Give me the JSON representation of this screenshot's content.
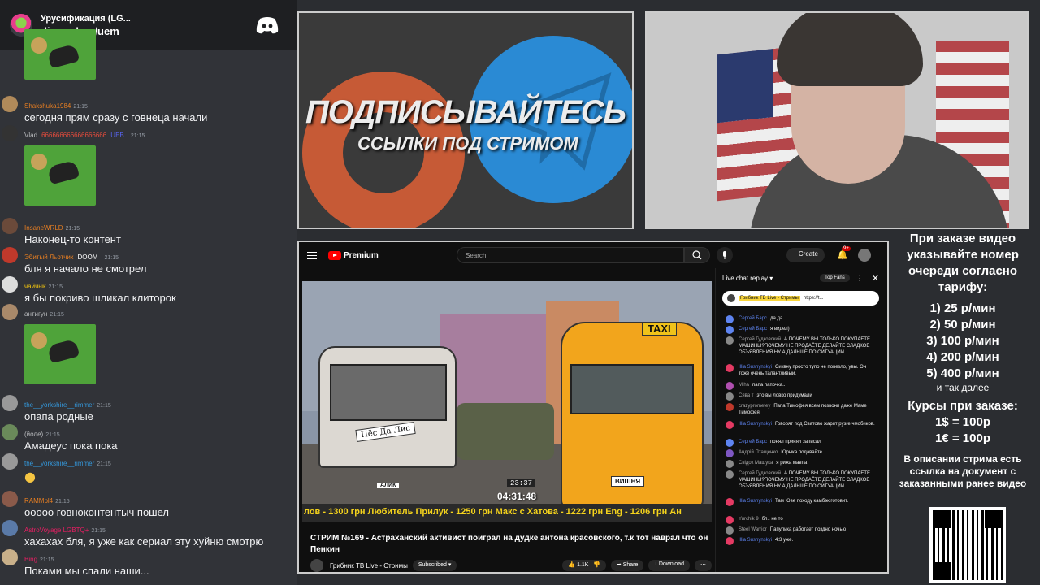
{
  "discord": {
    "server_name": "Урусификация (LG...",
    "server_link": "discord.gg/uem",
    "messages": [
      {
        "user": "Shakshuka1984",
        "time": "21:15",
        "text": "сегодня прям сразу с говнеца начали",
        "color": "#e67e22"
      },
      {
        "user": "Vlad",
        "extra": "666666666666666666",
        "badge": "UEB",
        "time": "21:15",
        "text": "",
        "color": "#b9bbbe"
      },
      {
        "user": "InsaneWRLD",
        "time": "21:15",
        "text": "Наконец-то контент",
        "color": "#e67e22"
      },
      {
        "user": "Эбитый Льотчик",
        "badge": "DOOM",
        "time": "21:15",
        "text": "бля я начало не смотрел",
        "color": "#e67e22"
      },
      {
        "user": "чайчык",
        "time": "21:15",
        "text": "я бы покриво шликал клиторок",
        "color": "#f1c40f"
      },
      {
        "user": "антигун",
        "time": "21:15",
        "text": "",
        "color": "#b9bbbe"
      },
      {
        "user": "the__yorkshire__rimmer",
        "time": "21:15",
        "text": "опапа родные",
        "color": "#3498db"
      },
      {
        "user": "(йоле)",
        "time": "21:15",
        "text": "Амадеус пока пока",
        "color": "#b9bbbe"
      },
      {
        "user": "the__yorkshire__rimmer",
        "time": "21:15",
        "text": "",
        "color": "#3498db"
      },
      {
        "user": "RAMMbl4",
        "time": "21:15",
        "text": "ооооо говноконтентыч пошел",
        "color": "#e67e22"
      },
      {
        "user": "AstroVoyage LGBTQ+",
        "time": "21:15",
        "text": "хахахах бля, я уже как сериал эту хуйню смотрю",
        "color": "#e91e63"
      },
      {
        "user": "Bing",
        "time": "21:15",
        "text": "Поками мы спали наши...",
        "color": "#e91e63"
      }
    ]
  },
  "promo": {
    "title": "ПОДПИСЫВАЙТЕСЬ",
    "subtitle": "ССЫЛКИ ПОД СТРИМОМ"
  },
  "youtube": {
    "brand": "Premium",
    "search_placeholder": "Search",
    "create_label": "Create",
    "notif_count": "9+",
    "video": {
      "taxi_sign": "TAXI",
      "plate": "ВИШНЯ",
      "dog_sign": "Пёс Да Лис",
      "alik": "АЛИК",
      "time_small": "23:37",
      "time_big": "04:31:48",
      "ticker": "лов - 1300 грн   Любитель Прилук - 1250 грн   Макс с Хатова - 1222 грн   Eng - 1206 грн   Ан"
    },
    "title": "СТРИМ №169 - Астраханский активист поиграл на дудке антона красовского, т.к тот наврал что он Пенкин",
    "channel": "Грибник ТВ Live - Стримы",
    "subscribed": "Subscribed",
    "likes": "1.1K",
    "share": "Share",
    "download": "Download",
    "chat": {
      "title": "Live chat replay",
      "top_fans": "Top Fans",
      "pinned_user": "Грибник ТВ Live - Стримы",
      "pinned_text": "https://t...",
      "messages": [
        {
          "author": "Сергей Барс",
          "mod": true,
          "text": "да да",
          "color": "#5e84f1"
        },
        {
          "author": "Сергей Барс",
          "mod": true,
          "text": "я видел)",
          "color": "#5e84f1"
        },
        {
          "author": "Сергей Гудковский",
          "mod": false,
          "text": "А ПОЧЕМУ ВЫ ТОЛЬКО ПОКУПАЕТЕ МАШИНЫ?ПОЧЕМУ НЕ ПРОДАЁТЕ ДЕЛАЙТЕ СЛАДКОЕ ОБЪЯВЛЕНИЯ НУ А ДАЛЬШЕ ПО СИТУАЦИИ",
          "color": "#888"
        },
        {
          "author": "Illia Sushynskyi",
          "mod": true,
          "text": "Сиквну просто тупо не повезло, увы. Он тоже очень талантливый.",
          "color": "#e53a63"
        },
        {
          "author": "Miha",
          "mod": false,
          "text": "папа папочка...",
          "color": "#b04fb0"
        },
        {
          "author": "Сява т",
          "mod": false,
          "text": "это вы ловко придумали",
          "color": "#888"
        },
        {
          "author": "crazyprometey",
          "mod": false,
          "text": "Папа Тимофея всем позвони даже Маме Тимофея",
          "color": "#c0392b"
        },
        {
          "author": "Illia Sushynskyi",
          "mod": true,
          "text": "Говорят под Сватово жарят рузге чмобиков.",
          "color": "#e53a63"
        },
        {
          "author": "Сергей Барс",
          "mod": true,
          "text": "понял принял записал",
          "color": "#5e84f1"
        },
        {
          "author": "Андрій Птащенко",
          "mod": false,
          "text": "Юрыка подавайте",
          "color": "#7e57c2"
        },
        {
          "author": "Свідок Машука",
          "mod": false,
          "text": "я рижа мавпа",
          "color": "#888"
        },
        {
          "author": "Сергей Гудковский",
          "mod": false,
          "text": "А ПОЧЕМУ ВЫ ТОЛЬКО ПОКУПАЕТЕ МАШИНЫ?ПОЧЕМУ НЕ ПРОДАЁТЕ ДЕЛАЙТЕ СЛАДКОЕ ОБЪЯВЛЕНИЯ НУ А ДАЛЬШЕ ПО СИТУАЦИИ",
          "color": "#888"
        },
        {
          "author": "Illia Sushynskyi",
          "mod": true,
          "text": "Там Юве походу камбэк готовит.",
          "color": "#e53a63"
        },
        {
          "author": "Yurchik 9",
          "mod": false,
          "text": "бл.. не то",
          "color": "#e53a63"
        },
        {
          "author": "Steel Warrior",
          "mod": false,
          "text": "Папулька работает поздно ночью",
          "color": "#888"
        },
        {
          "author": "Illia Sushynskyi",
          "mod": true,
          "text": "4:3 уже.",
          "color": "#e53a63"
        }
      ]
    }
  },
  "info": {
    "order_note": "При заказе видео указывайте номер очереди согласно тарифу:",
    "tariffs": [
      "1) 25 р/мин",
      "2) 50 р/мин",
      "3) 100 р/мин",
      "4) 200 р/мин",
      "5) 400 р/мин"
    ],
    "etc": "и так далее",
    "rates_title": "Курсы при заказе:",
    "rates": [
      "1$ = 100р",
      "1€ = 100р"
    ],
    "desc_note": "В описании стрима есть ссылка на документ с заказанными ранее видео"
  }
}
